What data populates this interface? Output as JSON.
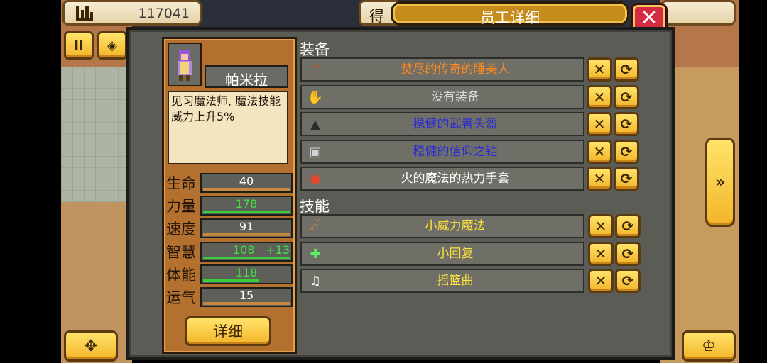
{
  "hud": {
    "money": "117041",
    "partial_tab": "得"
  },
  "window": {
    "title": "员工详细"
  },
  "character": {
    "name": "帕米拉",
    "description": "见习魔法师, 魔法技能威力上升5%",
    "detail_button": "详细"
  },
  "stats": [
    {
      "label": "生命",
      "value": "40",
      "bonus": "",
      "bar_color": "#c5883c",
      "fill": 1.0
    },
    {
      "label": "力量",
      "value": "178",
      "bonus": "",
      "bar_color": "#34d13a",
      "fill": 1.0
    },
    {
      "label": "速度",
      "value": "91",
      "bonus": "",
      "bar_color": "#c5883c",
      "fill": 1.0
    },
    {
      "label": "智慧",
      "value": "108",
      "bonus": "+13",
      "bar_color": "#34d13a",
      "fill": 1.0
    },
    {
      "label": "体能",
      "value": "118",
      "bonus": "",
      "bar_color": "#34d13a",
      "fill": 0.65
    },
    {
      "label": "运气",
      "value": "15",
      "bonus": "",
      "bar_color": "#c5883c",
      "fill": 1.0
    }
  ],
  "sections": {
    "equipment": "装备",
    "skills": "技能"
  },
  "equipment": [
    {
      "name": "焚尽的传奇的睡美人",
      "color": "#ff8a1e",
      "icon": "staff-icon"
    },
    {
      "name": "没有装备",
      "color": "#d8d8d8",
      "icon": "glove-slot-icon"
    },
    {
      "name": "稳健的武者头盔",
      "color": "#2a2bd6",
      "icon": "helmet-icon"
    },
    {
      "name": "稳健的信仰之铠",
      "color": "#2a2bd6",
      "icon": "armor-icon"
    },
    {
      "name": "火的魔法的热力手套",
      "color": "#ffffff",
      "icon": "gauntlet-icon"
    }
  ],
  "skills": [
    {
      "name": "小威力魔法",
      "color": "#ffe53b",
      "icon": "fireball-icon"
    },
    {
      "name": "小回复",
      "color": "#ffe53b",
      "icon": "heal-cross-icon"
    },
    {
      "name": "摇篮曲",
      "color": "#ffe53b",
      "icon": "music-note-icon"
    }
  ]
}
